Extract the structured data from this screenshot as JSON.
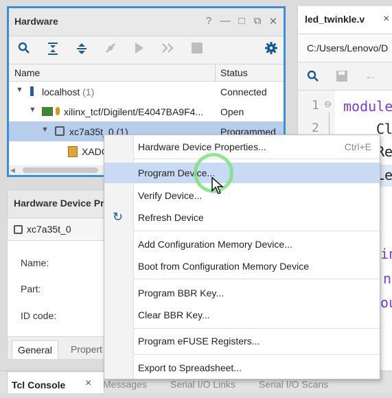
{
  "hardware": {
    "title": "Hardware",
    "controls": [
      "?",
      "—",
      "□",
      "⧉",
      "✕"
    ],
    "columns": {
      "name": "Name",
      "status": "Status"
    },
    "rows": [
      {
        "name": "localhost",
        "count": "(1)",
        "status": "Connected"
      },
      {
        "name": "xilinx_tcf/Digilent/E4047BA9F4...",
        "status": "Open"
      },
      {
        "name": "xc7a35t_0",
        "count": "(1)",
        "status": "Programmed"
      },
      {
        "name": "XADC"
      }
    ]
  },
  "properties": {
    "title": "Hardware Device Pr",
    "device": "xc7a35t_0",
    "labels": [
      "Name:",
      "Part:",
      "ID code:"
    ],
    "tabs": [
      "General",
      "Propert"
    ]
  },
  "editor": {
    "tab": "led_twinkle.v",
    "close": "×",
    "path": "C:/Users/Lenovo/D",
    "line_numbers": [
      "1",
      "2"
    ],
    "code": [
      "module",
      "Cl",
      "Re",
      "Le",
      "in",
      "n",
      "ou"
    ]
  },
  "context_menu": {
    "items": [
      {
        "label": "Hardware Device Properties...",
        "shortcut": "Ctrl+E"
      },
      {
        "label": "Program Device..."
      },
      {
        "label": "Verify Device..."
      },
      {
        "label": "Refresh Device",
        "icon": "refresh-icon"
      },
      {
        "label": "Add Configuration Memory Device..."
      },
      {
        "label": "Boot from Configuration Memory Device"
      },
      {
        "label": "Program BBR Key..."
      },
      {
        "label": "Clear BBR Key..."
      },
      {
        "label": "Program eFUSE Registers..."
      },
      {
        "label": "Export to Spreadsheet..."
      }
    ]
  },
  "bottom_tabs": [
    "Tcl Console",
    "Messages",
    "Serial I/O Links",
    "Serial I/O Scans"
  ],
  "bottom_close": "×",
  "colors": {
    "accent": "#3c8fd6",
    "selection": "#b7cdec",
    "menu_highlight": "#c9daf5",
    "cursor_ring": "#7fe07f"
  }
}
